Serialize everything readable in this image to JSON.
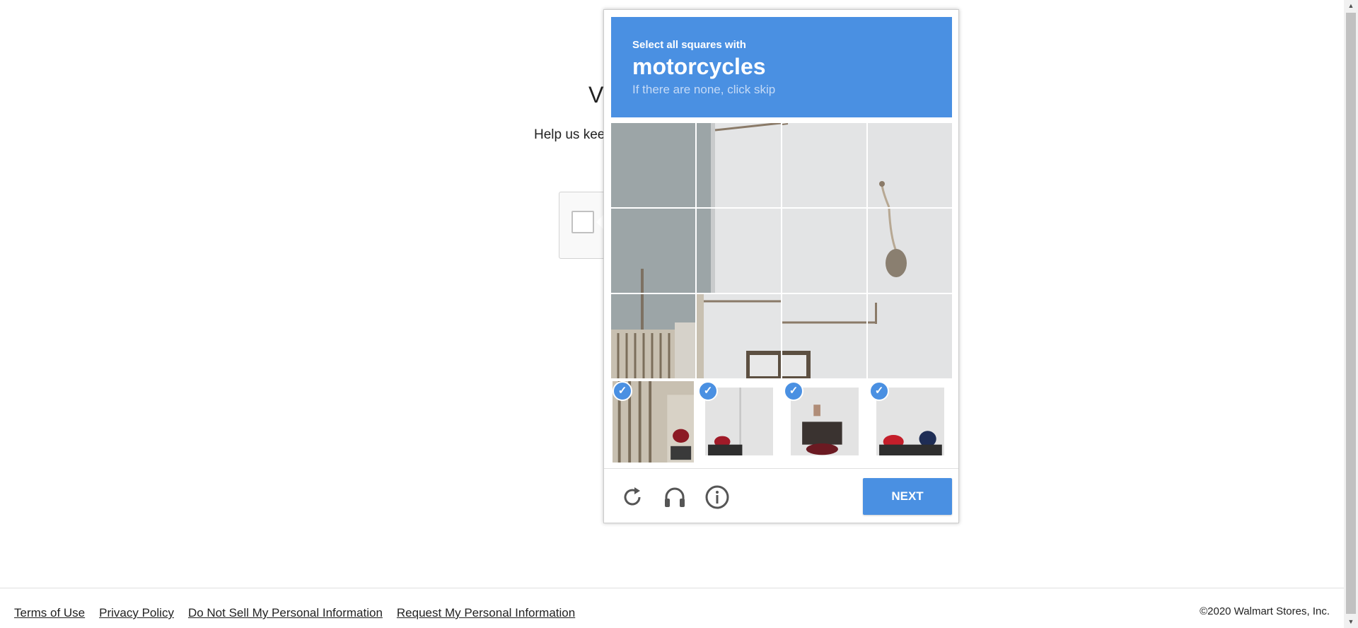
{
  "page": {
    "heading": "Ve",
    "subtitle": "Help us kee"
  },
  "captcha": {
    "instruction": "Select all squares with",
    "keyword": "motorcycles",
    "hint": "If there are none, click skip",
    "next_label": "NEXT",
    "selected_tiles": [
      13,
      14,
      15,
      16
    ],
    "accent_color": "#4a90e2",
    "icons": [
      "reload-icon",
      "audio-icon",
      "info-icon"
    ]
  },
  "footer": {
    "links": [
      "Terms of Use",
      "Privacy Policy",
      "Do Not Sell My Personal Information",
      "Request My Personal Information"
    ],
    "copyright": "©2020 Walmart Stores, Inc."
  }
}
